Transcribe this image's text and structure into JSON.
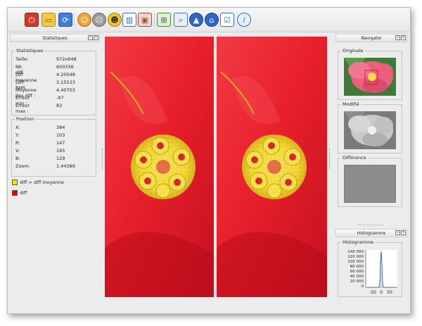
{
  "toolbar": {
    "icons": [
      "power-icon",
      "folder-open-icon",
      "refresh-icon",
      "smiley-icon",
      "sad-face-icon",
      "smile-icon",
      "layout-icon",
      "image-view-icon",
      "zoom-fit-icon",
      "zoom-icon",
      "arrow-up-icon",
      "arrow-home-icon",
      "checklist-icon",
      "info-icon"
    ]
  },
  "statistics_panel": {
    "title": "Statistiques",
    "group_title": "Statistiques",
    "rows": [
      {
        "label": "Taille:",
        "value": "972x648"
      },
      {
        "label": "Nb diff :",
        "value": "600336"
      },
      {
        "label": "Diff moyenne :",
        "value": "4.20048"
      },
      {
        "label": "Diff RMS :",
        "value": "3.15533"
      },
      {
        "label": "Moyenne des diff :",
        "value": "4.40703"
      },
      {
        "label": "Erreur min :",
        "value": "-97"
      },
      {
        "label": "Erreur max :",
        "value": "83"
      }
    ],
    "position_title": "Position",
    "position_rows": [
      {
        "label": "X:",
        "value": "384"
      },
      {
        "label": "Y:",
        "value": "103"
      },
      {
        "label": "R:",
        "value": "147"
      },
      {
        "label": "V:",
        "value": "165"
      },
      {
        "label": "B:",
        "value": "129"
      },
      {
        "label": "Zoom:",
        "value": "1.44389"
      }
    ],
    "legend": [
      {
        "label": "diff > diff moyenne",
        "color": "#f4e400"
      },
      {
        "label": "diff",
        "color": "#e00000"
      }
    ]
  },
  "navigator_panel": {
    "title": "Navigator",
    "original_title": "Originale",
    "modified_title": "Modifié",
    "difference_title": "Différence"
  },
  "histogram_panel": {
    "title": "Histogramme",
    "group_title": "Histogramme",
    "y_ticks": [
      "140 000",
      "120 000",
      "100 000",
      "80 000",
      "60 000",
      "40 000",
      "20 000",
      "0"
    ],
    "x_ticks": [
      "-50",
      "0",
      "50"
    ]
  },
  "colors": {
    "flower_red": "#e8202c",
    "pollen_yellow": "#f2e43a",
    "difference_gray": "#8c8c8c"
  }
}
